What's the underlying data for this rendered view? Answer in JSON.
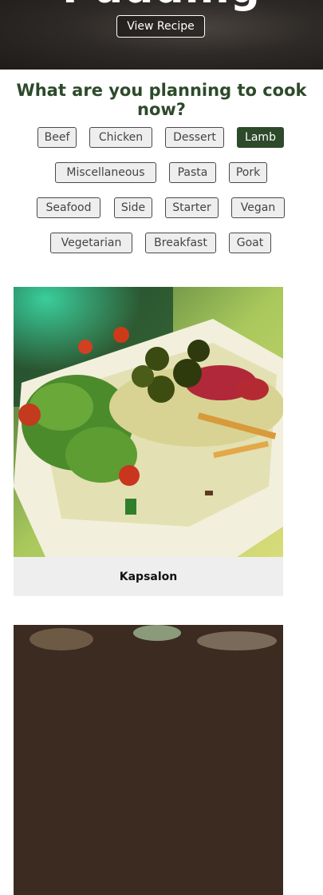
{
  "hero": {
    "title": "Pudding",
    "view_button": "View Recipe"
  },
  "planning_heading": "What are you planning to cook now?",
  "categories": [
    {
      "label": "Beef",
      "active": false
    },
    {
      "label": "Chicken",
      "active": false
    },
    {
      "label": "Dessert",
      "active": false
    },
    {
      "label": "Lamb",
      "active": true
    },
    {
      "label": "Miscellaneous",
      "active": false
    },
    {
      "label": "Pasta",
      "active": false
    },
    {
      "label": "Pork",
      "active": false
    },
    {
      "label": "Seafood",
      "active": false
    },
    {
      "label": "Side",
      "active": false
    },
    {
      "label": "Starter",
      "active": false
    },
    {
      "label": "Vegan",
      "active": false
    },
    {
      "label": "Vegetarian",
      "active": false
    },
    {
      "label": "Breakfast",
      "active": false
    },
    {
      "label": "Goat",
      "active": false
    }
  ],
  "meals": [
    {
      "title": "Kapsalon"
    },
    {
      "title": ""
    }
  ],
  "colors": {
    "accent": "#2d4a2b",
    "chip_bg": "#eeeeee",
    "card_caption_bg": "#eeeeee"
  }
}
